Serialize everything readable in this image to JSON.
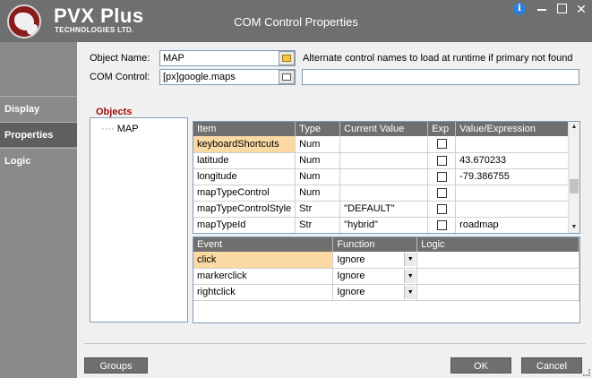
{
  "window": {
    "brand": "PVX Plus",
    "brand_sub": "TECHNOLOGIES LTD.",
    "title": "COM Control Properties",
    "info": "i"
  },
  "nav": {
    "items": [
      {
        "label": "Display",
        "active": false
      },
      {
        "label": "Properties",
        "active": true
      },
      {
        "label": "Logic",
        "active": false
      }
    ]
  },
  "form": {
    "object_name_label": "Object Name:",
    "object_name_value": "MAP",
    "com_control_label": "COM Control:",
    "com_control_value": "[px]google.maps",
    "alt_names_label": "Alternate control names to load at runtime if primary not found",
    "alt_names_value": ""
  },
  "objects": {
    "title": "Objects",
    "items": [
      "MAP"
    ]
  },
  "properties": {
    "columns": [
      "Item",
      "Type",
      "Current Value",
      "Exp",
      "Value/Expression"
    ],
    "rows": [
      {
        "item": "keyboardShortcuts",
        "type": "Num",
        "current": "",
        "value": ""
      },
      {
        "item": "latitude",
        "type": "Num",
        "current": "",
        "value": "43.670233"
      },
      {
        "item": "longitude",
        "type": "Num",
        "current": "",
        "value": "-79.386755"
      },
      {
        "item": "mapTypeControl",
        "type": "Num",
        "current": "",
        "value": ""
      },
      {
        "item": "mapTypeControlStyle",
        "type": "Str",
        "current": "\"DEFAULT\"",
        "value": ""
      },
      {
        "item": "mapTypeId",
        "type": "Str",
        "current": "\"hybrid\"",
        "value": "roadmap"
      }
    ]
  },
  "events": {
    "columns": [
      "Event",
      "Function",
      "Logic"
    ],
    "rows": [
      {
        "event": "click",
        "function": "Ignore",
        "logic": ""
      },
      {
        "event": "markerclick",
        "function": "Ignore",
        "logic": ""
      },
      {
        "event": "rightclick",
        "function": "Ignore",
        "logic": ""
      }
    ]
  },
  "buttons": {
    "groups": "Groups",
    "ok": "OK",
    "cancel": "Cancel"
  },
  "colors": {
    "titlebar": "#6f6f6f",
    "nav_active": "#5f5f5f",
    "objects_title": "#a01010",
    "selection": "#fbd9a3"
  }
}
